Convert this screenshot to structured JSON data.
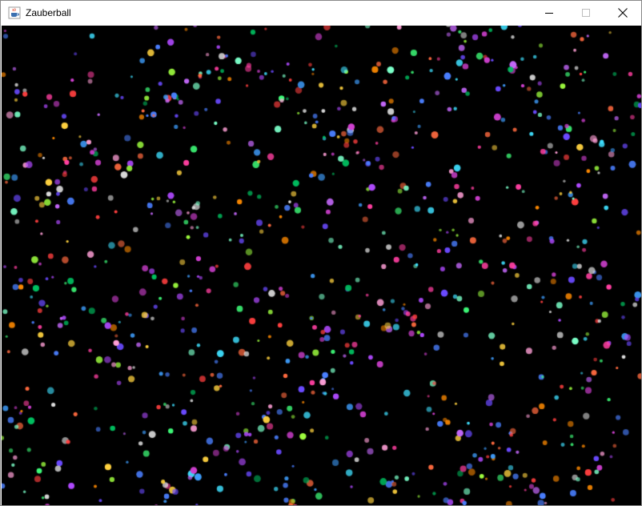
{
  "window": {
    "title": "Zauberball",
    "controls": {
      "minimize": "minimize-icon",
      "maximize": "maximize-icon",
      "close": "close-icon"
    }
  },
  "canvas": {
    "background": "#000000",
    "palette": [
      "#ff3fa0",
      "#3fff7a",
      "#4a7fff",
      "#ffd23f",
      "#b04aff",
      "#3fe0ff",
      "#ff6a3f",
      "#9fff3f",
      "#ff3f3f",
      "#3f9fff",
      "#ff9fd6",
      "#7affc8",
      "#c86aff",
      "#6a4aff",
      "#e0e0e0",
      "#ff8a00",
      "#00c060",
      "#d040d0"
    ]
  }
}
